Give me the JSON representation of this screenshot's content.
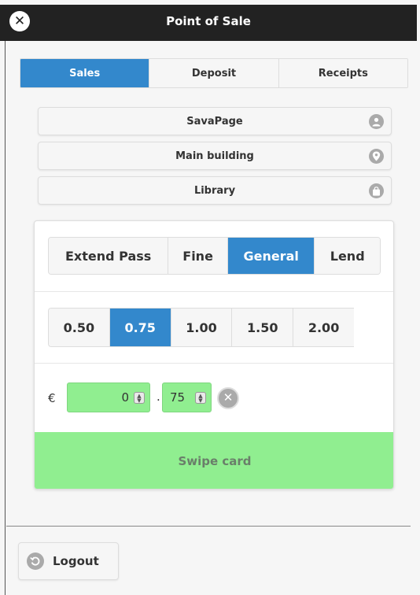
{
  "header": {
    "title": "Point of Sale",
    "close_icon": "close-icon",
    "close_glyph": "✕"
  },
  "tabs": [
    {
      "label": "Sales",
      "active": true
    },
    {
      "label": "Deposit",
      "active": false
    },
    {
      "label": "Receipts",
      "active": false
    }
  ],
  "info": {
    "user": {
      "label": "SavaPage",
      "icon": "user-icon"
    },
    "location": {
      "label": "Main building",
      "icon": "location-pin-icon"
    },
    "shop": {
      "label": "Library",
      "icon": "shopping-bag-icon"
    }
  },
  "categories": [
    {
      "label": "Extend Pass",
      "active": false
    },
    {
      "label": "Fine",
      "active": false
    },
    {
      "label": "General",
      "active": true
    },
    {
      "label": "Lend",
      "active": false
    }
  ],
  "amounts": [
    {
      "label": "0.50",
      "active": false
    },
    {
      "label": "0.75",
      "active": true
    },
    {
      "label": "1.00",
      "active": false
    },
    {
      "label": "1.50",
      "active": false
    },
    {
      "label": "2.00",
      "active": false
    }
  ],
  "amount_entry": {
    "currency": "€",
    "main_value": "0",
    "separator": ".",
    "cents_value": "75",
    "clear_icon": "clear-icon"
  },
  "swipe_label": "Swipe card",
  "logout": {
    "label": "Logout",
    "icon": "logout-icon"
  },
  "colors": {
    "header_bg": "#222222",
    "accent": "#3388cc",
    "input_green": "#90ee90",
    "icon_gray": "#aaaaaa"
  }
}
